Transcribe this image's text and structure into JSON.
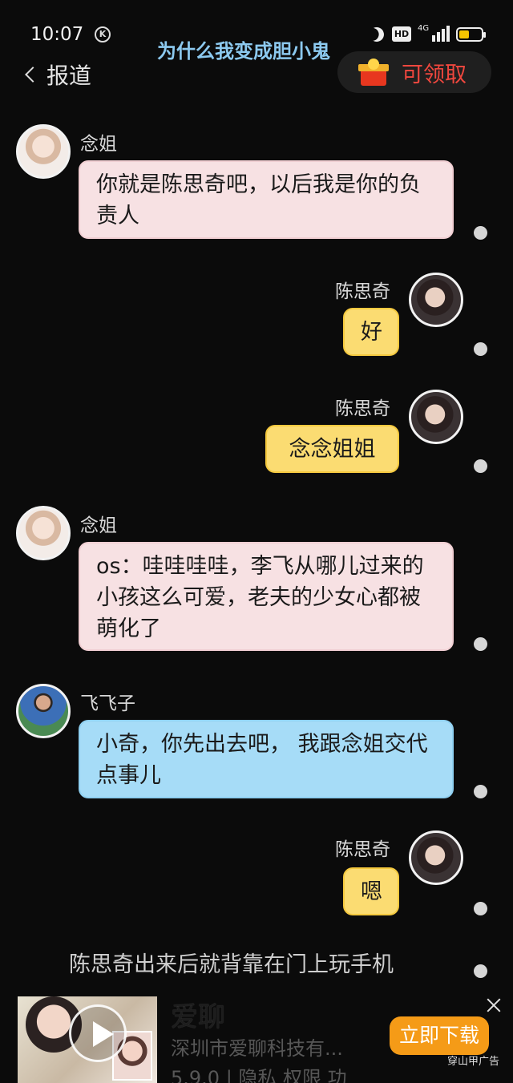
{
  "status_bar": {
    "time": "10:07",
    "k_badge": "K",
    "hd_label": "HD",
    "signal_label": "4G",
    "battery_level": 0.45
  },
  "header": {
    "story_title": "为什么我变成胆小鬼",
    "back_label": "报道",
    "claim_label": "可领取"
  },
  "messages": [
    {
      "sender": "念姐",
      "text": "你就是陈思奇吧，以后我是你的负责人"
    },
    {
      "sender": "陈思奇",
      "text": "好"
    },
    {
      "sender": "陈思奇",
      "text": "念念姐姐"
    },
    {
      "sender": "念姐",
      "text": "os：哇哇哇哇，李飞从哪儿过来的小孩这么可爱，老夫的少女心都被萌化了"
    },
    {
      "sender": "飞飞子",
      "text": "小奇，你先出去吧， 我跟念姐交代点事儿"
    },
    {
      "sender": "陈思奇",
      "text": "嗯"
    }
  ],
  "narration": "陈思奇出来后就背靠在门上玩手机",
  "ad": {
    "app_name": "爱聊",
    "company": "深圳市爱聊科技有...",
    "meta": "5.9.0 | 隐私 权限 功",
    "download_label": "立即下载",
    "source_label": "穿山甲广告"
  },
  "colors": {
    "pink_bubble": "#f7e1e3",
    "yellow_bubble": "#fbdc72",
    "blue_bubble": "#a6dcf7",
    "title": "#8cc9ef",
    "claim": "#f0473e",
    "download": "#f59b17"
  }
}
